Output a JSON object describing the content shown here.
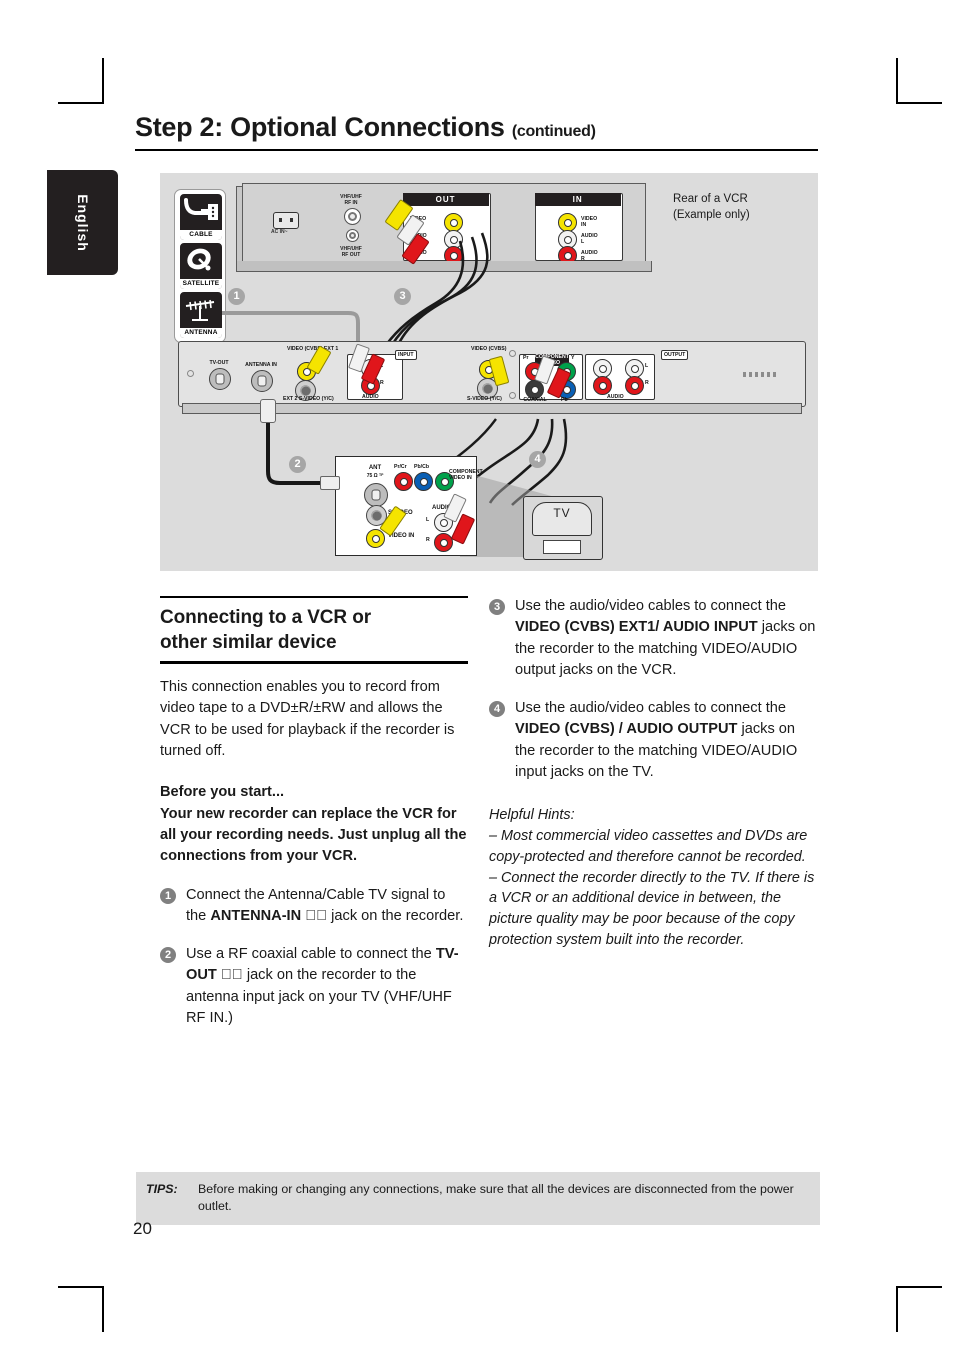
{
  "header": {
    "title": "Step 2: Optional Connections",
    "continued": "(continued)"
  },
  "language_tab": "English",
  "diagram": {
    "note_line1": "Rear of a VCR",
    "note_line2": "(Example only)",
    "source_cards": [
      {
        "label": "CABLE",
        "icon": "cable-box-icon"
      },
      {
        "label": "SATELLITE",
        "icon": "satellite-dish-icon"
      },
      {
        "label": "ANTENNA",
        "icon": "antenna-icon"
      }
    ],
    "vcr": {
      "ac_in": "AC IN~",
      "rf_in": "VHF/UHF\nRF IN",
      "rf_out": "VHF/UHF\nRF OUT",
      "out_panel": {
        "header": "OUT",
        "jacks": [
          "VIDEO OUT",
          "AUDIO L",
          "AUDIO R"
        ]
      },
      "in_panel": {
        "header": "IN",
        "jacks": [
          "VIDEO IN",
          "AUDIO L",
          "AUDIO R"
        ]
      }
    },
    "recorder": {
      "tv_out": "TV-OUT",
      "antenna_in": "ANTENNA IN",
      "video_cvbs_ext1": "VIDEO (CVBS) EXT 1",
      "ext2_svideo": "EXT 2 S-VIDEO (Y/C)",
      "input_tag": "INPUT",
      "input_audio": "AUDIO",
      "input_l": "L",
      "input_r": "R",
      "video_cvbs": "VIDEO (CVBS)",
      "svideo_out": "S-VIDEO (Y/C)",
      "coaxial_digital_audio": "COAXIAL DIGITAL AUDIO",
      "component_header": "COMPONENT VIDEO",
      "component_pr": "Pr",
      "component_y": "Y",
      "component_pb": "Pb",
      "output_tag": "OUTPUT",
      "output_audio": "AUDIO",
      "output_l": "L",
      "output_r": "R"
    },
    "tv_panel": {
      "ant": "ANT",
      "ant_sub": "75 Ω ᵀᴾ",
      "pr_cr": "Pr/Cr",
      "pb_cb": "Pb/Cb",
      "component_video_in": "COMPONENT VIDEO IN",
      "s_video": "S-VIDEO",
      "video_in": "VIDEO IN",
      "audio": "AUDIO",
      "audio_l": "L",
      "audio_r": "R"
    },
    "tv_label": "TV",
    "badges": [
      "1",
      "2",
      "3",
      "4"
    ]
  },
  "left_column": {
    "section_title_line1": "Connecting to a VCR or",
    "section_title_line2": "other similar device",
    "intro": "This connection enables you to record from video tape to a DVD±R/±RW and allows the VCR to be used for playback if the recorder is turned off.",
    "before_you_start_heading": "Before you start...",
    "before_you_start_body": "Your new recorder can replace the VCR for all your recording needs. Just unplug all the connections from your VCR.",
    "steps": [
      {
        "num": "1",
        "pre": "Connect the Antenna/Cable TV signal to the ",
        "bold": "ANTENNA-IN",
        "icon": "rf-jack-icon",
        "post": " jack on the recorder."
      },
      {
        "num": "2",
        "pre": "Use a RF coaxial cable to connect the ",
        "bold": "TV-OUT",
        "icon": "rf-jack-icon",
        "post": " jack on the recorder to the antenna input jack on your TV (VHF/UHF RF IN.)"
      }
    ]
  },
  "right_column": {
    "steps": [
      {
        "num": "3",
        "pre": "Use the audio/video cables to connect the ",
        "bold": "VIDEO (CVBS) EXT1/ AUDIO INPUT",
        "post": " jacks on the recorder to the matching VIDEO/AUDIO output jacks on the VCR."
      },
      {
        "num": "4",
        "pre": "Use the audio/video cables to connect the ",
        "bold": "VIDEO (CVBS) / AUDIO OUTPUT",
        "post": " jacks on the recorder to the matching VIDEO/AUDIO input jacks on the TV."
      }
    ],
    "hints_heading": "Helpful Hints:",
    "hint1": "– Most commercial video cassettes and DVDs are copy-protected and therefore cannot be recorded.",
    "hint2": "– Connect the recorder directly to the TV. If there is a VCR or an additional device in between, the picture quality may be poor because of the copy protection system built into the recorder."
  },
  "footer": {
    "tips_label": "TIPS:",
    "tips_text": "Before making or changing any connections, make sure that all the devices are disconnected from the power outlet.",
    "page_number": "20"
  },
  "colors": {
    "diagram_bg": "#dcdcdc",
    "tips_bg": "#dcdcdc",
    "badge_gray": "#a6a6a6",
    "yellow": "#f5e400",
    "red": "#e0161b",
    "white_jack": "#f2f2f2",
    "green": "#00a14b",
    "blue": "#0a5fb4"
  }
}
